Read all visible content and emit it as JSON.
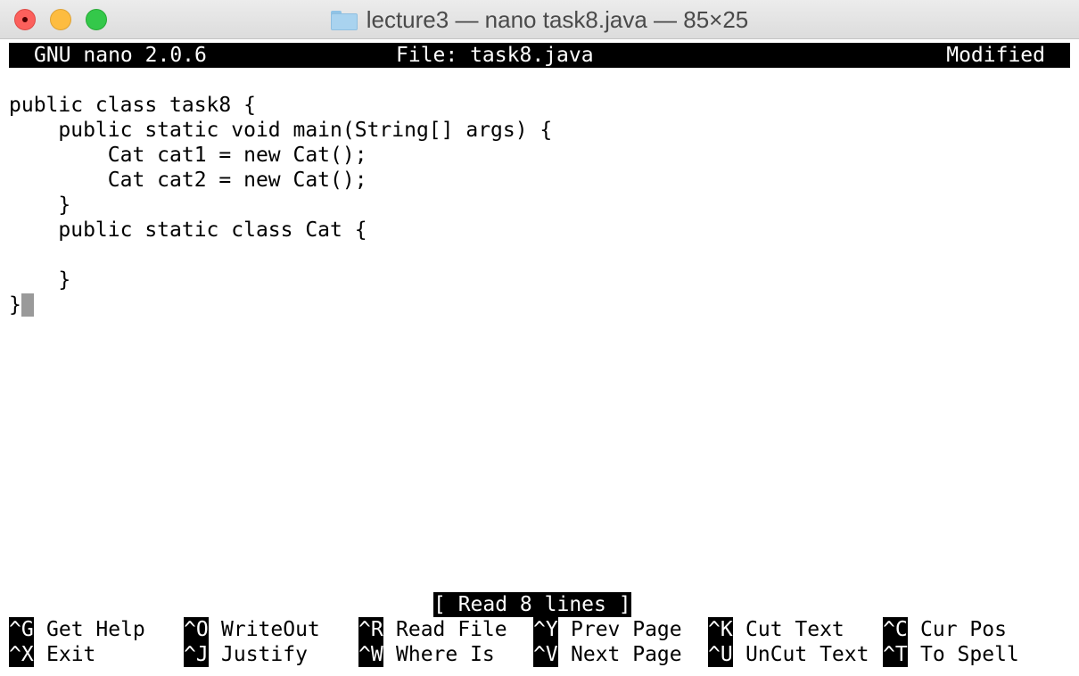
{
  "window": {
    "title": "lecture3 — nano task8.java — 85×25"
  },
  "nano": {
    "app": "GNU nano 2.0.6",
    "file": "File: task8.java",
    "state": "Modified",
    "status_message": "[ Read 8 lines ]",
    "code_lines": [
      "public class task8 {",
      "    public static void main(String[] args) {",
      "        Cat cat1 = new Cat();",
      "        Cat cat2 = new Cat();",
      "    }",
      "    public static class Cat {",
      "",
      "    }",
      "}"
    ],
    "shortcuts_row1": [
      {
        "key": "^G",
        "label": "Get Help"
      },
      {
        "key": "^O",
        "label": "WriteOut"
      },
      {
        "key": "^R",
        "label": "Read File"
      },
      {
        "key": "^Y",
        "label": "Prev Page"
      },
      {
        "key": "^K",
        "label": "Cut Text"
      },
      {
        "key": "^C",
        "label": "Cur Pos"
      }
    ],
    "shortcuts_row2": [
      {
        "key": "^X",
        "label": "Exit"
      },
      {
        "key": "^J",
        "label": "Justify"
      },
      {
        "key": "^W",
        "label": "Where Is"
      },
      {
        "key": "^V",
        "label": "Next Page"
      },
      {
        "key": "^U",
        "label": "UnCut Text"
      },
      {
        "key": "^T",
        "label": "To Spell"
      }
    ]
  },
  "colors": {
    "close": "#fc605c",
    "minimize": "#fdbc40",
    "zoom": "#34c84a"
  }
}
